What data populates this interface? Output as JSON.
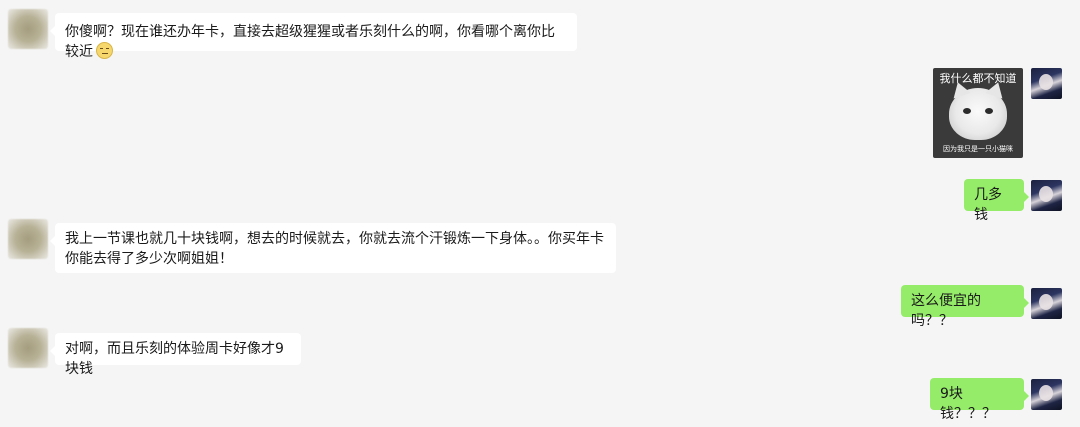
{
  "messages": [
    {
      "side": "left",
      "text": "你傻啊？现在谁还办年卡，直接去超级猩猩或者乐刻什么的啊，你看哪个离你比较近",
      "emoji": "unamused-face-emoji"
    },
    {
      "side": "right",
      "type": "sticker",
      "top_caption": "我什么都不知道",
      "bottom_caption": "因为我只是一只小猫咪"
    },
    {
      "side": "right",
      "text": "几多钱"
    },
    {
      "side": "left",
      "text": "我上一节课也就几十块钱啊，想去的时候就去，你就去流个汗锻炼一下身体。。你买年卡你能去得了多少次啊姐姐！"
    },
    {
      "side": "right",
      "text": "这么便宜的吗？？"
    },
    {
      "side": "left",
      "text": "对啊，而且乐刻的体验周卡好像才9块钱"
    },
    {
      "side": "right",
      "text": "9块钱？？？"
    }
  ],
  "colors": {
    "background": "#f5f5f5",
    "left_bubble": "#ffffff",
    "right_bubble": "#95ec69"
  }
}
